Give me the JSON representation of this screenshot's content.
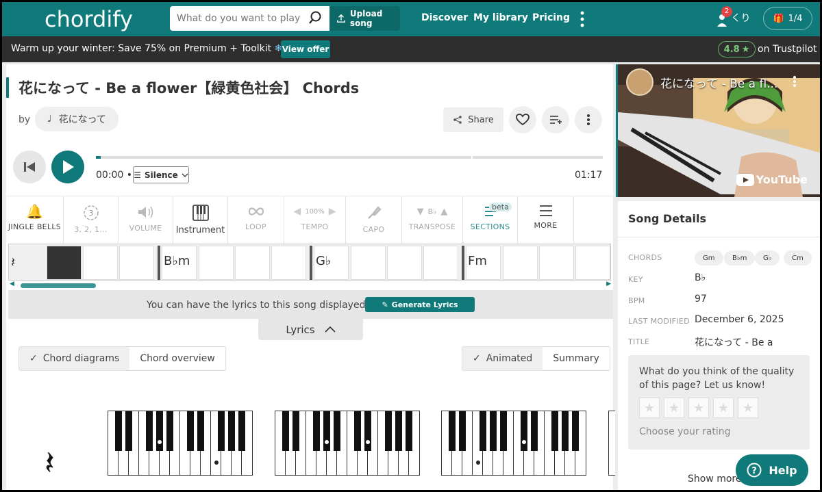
{
  "nav": {
    "logo": "chordify",
    "search_placeholder": "What do you want to play?",
    "upload": "Upload song",
    "links": [
      "Discover",
      "My library",
      "Pricing"
    ],
    "notifications": "2",
    "user": "くり",
    "gift": "1/4"
  },
  "promo": {
    "text": "Warm up your winter: Save 75% on Premium + Toolkit",
    "offer": "View offer",
    "rating": "4.8",
    "trustpilot": "on Trustpilot"
  },
  "song": {
    "title": "花になって - Be a flower【緑黄色社会】 Chords",
    "by": "by",
    "artist": "花になって",
    "share": "Share"
  },
  "player": {
    "current": "00:00",
    "mode": "Silence",
    "duration": "01:17",
    "progress": 0.01
  },
  "toolbar": [
    {
      "label": "JINGLE BELLS",
      "icon": "bells-icon"
    },
    {
      "label": "3, 2, 1...",
      "icon": "countdown-icon"
    },
    {
      "label": "VOLUME",
      "icon": "volume-icon"
    },
    {
      "label": "Instrument",
      "icon": "piano-icon"
    },
    {
      "label": "LOOP",
      "icon": "loop-icon"
    },
    {
      "label": "TEMPO",
      "icon": "tempo-icon",
      "value": "100%"
    },
    {
      "label": "CAPO",
      "icon": "capo-icon"
    },
    {
      "label": "TRANSPOSE",
      "icon": "transpose-icon",
      "value": "B♭"
    },
    {
      "label": "SECTIONS",
      "icon": "sections-icon",
      "badge": "beta"
    },
    {
      "label": "MORE",
      "icon": "menu-icon"
    }
  ],
  "chords_strip": [
    "B♭m",
    "G♭",
    "Fm"
  ],
  "lyrics": {
    "message": "You can have the lyrics to this song displayed here",
    "generate": "Generate Lyrics",
    "tab": "Lyrics"
  },
  "views": {
    "diagrams": "Chord diagrams",
    "overview": "Chord overview",
    "animated": "Animated",
    "summary": "Summary"
  },
  "video": {
    "title": "花になって - Be a fl...",
    "brand": "YouTube"
  },
  "details": {
    "heading": "Song Details",
    "chords_label": "CHORDS",
    "chords": [
      "Gm",
      "B♭m",
      "G♭",
      "Cm"
    ],
    "key_label": "KEY",
    "key": "B♭",
    "bpm_label": "BPM",
    "bpm": "97",
    "modified_label": "LAST MODIFIED",
    "modified": "December 6, 2025",
    "title_label": "TITLE",
    "title": "花になって - Be a",
    "question": "What do you think of the quality of this page? Let us know!",
    "rating_prompt": "Choose your rating",
    "show_more": "Show more"
  },
  "help": "Help",
  "colors": {
    "brand": "#107a7a",
    "promo": "#2e2e2e"
  }
}
